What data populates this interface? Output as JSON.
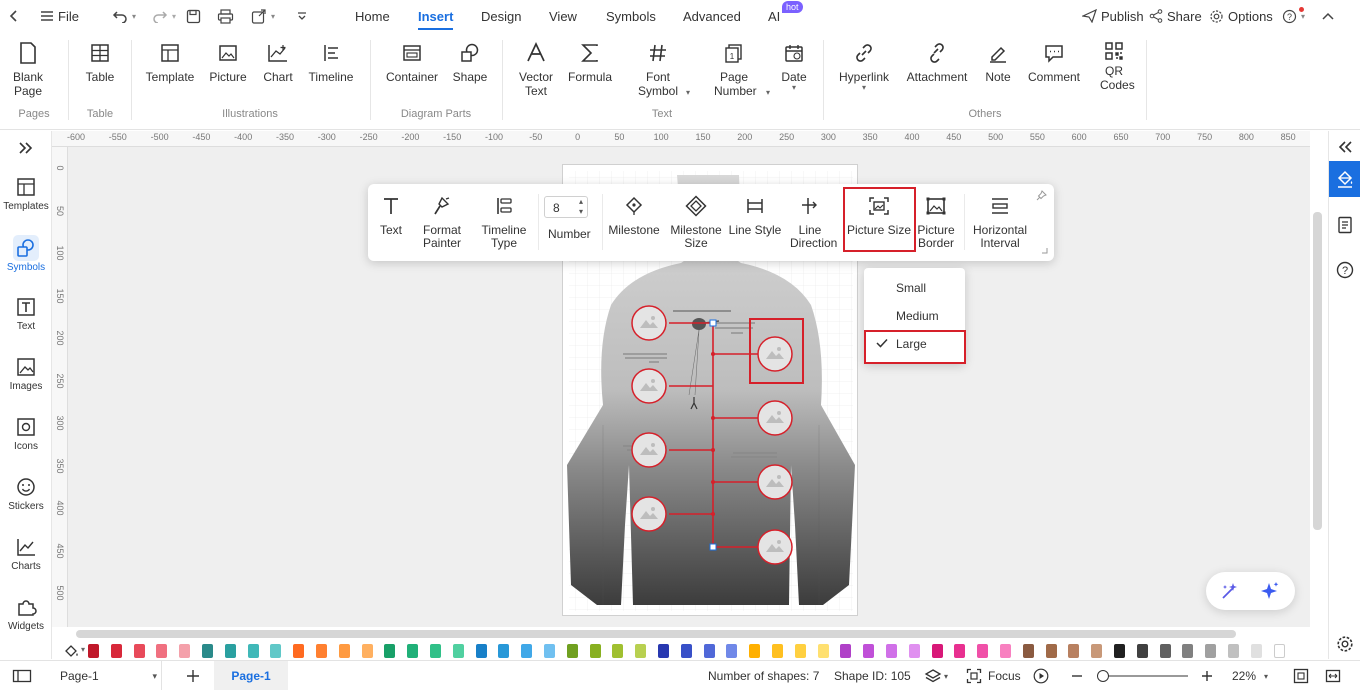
{
  "topbar": {
    "file_label": "File",
    "tabs": [
      {
        "label": "Home"
      },
      {
        "label": "Insert"
      },
      {
        "label": "Design"
      },
      {
        "label": "View"
      },
      {
        "label": "Symbols"
      },
      {
        "label": "Advanced"
      },
      {
        "label": "AI"
      }
    ],
    "ai_badge": "hot",
    "publish_label": "Publish",
    "share_label": "Share",
    "options_label": "Options"
  },
  "ribbon": {
    "buttons": [
      {
        "label": "Blank Page",
        "icon": "blank-page-icon"
      },
      {
        "label": "Table",
        "icon": "table-icon"
      },
      {
        "label": "Template",
        "icon": "template-icon"
      },
      {
        "label": "Picture",
        "icon": "picture-icon"
      },
      {
        "label": "Chart",
        "icon": "chart-icon"
      },
      {
        "label": "Timeline",
        "icon": "timeline-icon"
      },
      {
        "label": "Container",
        "icon": "container-icon"
      },
      {
        "label": "Shape",
        "icon": "shape-icon"
      },
      {
        "label": "Vector Text",
        "icon": "vector-text-icon"
      },
      {
        "label": "Formula",
        "icon": "formula-icon"
      },
      {
        "label": "Font Symbol",
        "icon": "font-symbol-icon"
      },
      {
        "label": "Page Number",
        "icon": "page-number-icon"
      },
      {
        "label": "Date",
        "icon": "date-icon"
      },
      {
        "label": "Hyperlink",
        "icon": "hyperlink-icon"
      },
      {
        "label": "Attachment",
        "icon": "attachment-icon"
      },
      {
        "label": "Note",
        "icon": "note-icon"
      },
      {
        "label": "Comment",
        "icon": "comment-icon"
      },
      {
        "label": "QR Codes",
        "icon": "qr-code-icon"
      }
    ],
    "groups": [
      "Pages",
      "Table",
      "Illustrations",
      "Diagram Parts",
      "Text",
      "Others"
    ]
  },
  "leftbar": {
    "items": [
      {
        "label": "Templates",
        "icon": "templates-icon"
      },
      {
        "label": "Symbols",
        "icon": "symbols-icon"
      },
      {
        "label": "Text",
        "icon": "text-icon"
      },
      {
        "label": "Images",
        "icon": "images-icon"
      },
      {
        "label": "Icons",
        "icon": "icons-icon"
      },
      {
        "label": "Stickers",
        "icon": "stickers-icon"
      },
      {
        "label": "Charts",
        "icon": "charts-icon"
      },
      {
        "label": "Widgets",
        "icon": "widgets-icon"
      }
    ]
  },
  "ruler": {
    "h": [
      "-600",
      "-550",
      "-500",
      "-450",
      "-400",
      "-350",
      "-300",
      "-250",
      "-200",
      "-150",
      "-100",
      "-50",
      "0",
      "50",
      "100",
      "150",
      "200",
      "250",
      "300",
      "350",
      "400",
      "450",
      "500",
      "550",
      "600",
      "650",
      "700",
      "750",
      "800",
      "850"
    ],
    "v": [
      "0",
      "50",
      "100",
      "150",
      "200",
      "250",
      "300",
      "350",
      "400",
      "450",
      "500"
    ]
  },
  "floatbar": {
    "buttons": [
      {
        "label": "Text",
        "icon": "text-tool-icon"
      },
      {
        "label": "Format Painter",
        "icon": "format-painter-icon"
      },
      {
        "label": "Timeline Type",
        "icon": "timeline-type-icon"
      },
      {
        "label": "Milestone",
        "icon": "milestone-icon"
      },
      {
        "label": "Milestone Size",
        "icon": "milestone-size-icon"
      },
      {
        "label": "Line Style",
        "icon": "line-style-icon"
      },
      {
        "label": "Line Direction",
        "icon": "line-direction-icon"
      },
      {
        "label": "Picture Size",
        "icon": "picture-size-icon"
      },
      {
        "label": "Picture Border",
        "icon": "picture-border-icon"
      },
      {
        "label": "Horizontal Interval",
        "icon": "horizontal-interval-icon"
      }
    ],
    "number_value": "8",
    "number_label": "Number"
  },
  "picture_size_menu": {
    "options": [
      {
        "label": "Small",
        "checked": false
      },
      {
        "label": "Medium",
        "checked": false
      },
      {
        "label": "Large",
        "checked": true
      }
    ]
  },
  "palette_colors": [
    "#c0182a",
    "#d8283a",
    "#e84a5a",
    "#f07080",
    "#f4a0aa",
    "#2a8a8a",
    "#2aa0a0",
    "#40b8b8",
    "#60c8c8",
    "#ff6a20",
    "#ff8030",
    "#ff9a40",
    "#ffb060",
    "#18a068",
    "#20b078",
    "#30c088",
    "#50d0a0",
    "#1880c8",
    "#2898d8",
    "#40a8e8",
    "#70c0f0",
    "#70a020",
    "#88b020",
    "#a0c030",
    "#b8d050",
    "#2838b0",
    "#3850c8",
    "#5068d8",
    "#7088e8",
    "#ffb000",
    "#ffc020",
    "#ffd040",
    "#ffe070",
    "#b040c8",
    "#c050d8",
    "#d070e8",
    "#e090f0",
    "#d81878",
    "#e83090",
    "#f050a8",
    "#f880c0",
    "#8a5a40",
    "#a06a48",
    "#b88060",
    "#c89878",
    "#202020",
    "#404040",
    "#606060",
    "#808080",
    "#a0a0a0",
    "#c0c0c0",
    "#e0e0e0",
    "#ffffff"
  ],
  "status": {
    "page_select": "Page-1",
    "page_tab": "Page-1",
    "shapes": "Number of shapes: 7",
    "shape_id": "Shape ID: 105",
    "focus_label": "Focus",
    "zoom": "22%"
  }
}
